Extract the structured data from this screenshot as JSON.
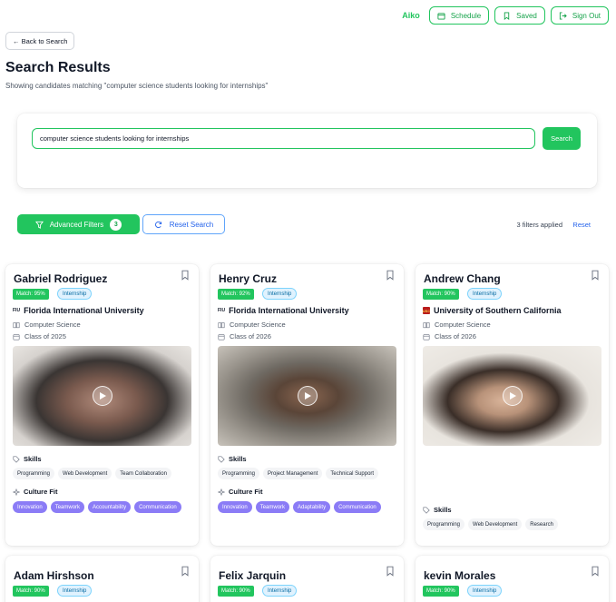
{
  "header": {
    "user_name": "Aiko",
    "schedule_label": "Schedule",
    "saved_label": "Saved",
    "signout_label": "Sign Out"
  },
  "nav": {
    "back_label": "← Back to Search"
  },
  "page": {
    "title": "Search Results",
    "subtitle": "Showing candidates matching \"computer science students looking for internships\""
  },
  "search": {
    "query": "computer science students looking for internships",
    "button_label": "Search"
  },
  "filters": {
    "advanced_label": "Advanced Filters",
    "count": "3",
    "reset_search_label": "Reset Search",
    "applied_text": "3 filters applied",
    "reset_label": "Reset"
  },
  "labels": {
    "skills": "Skills",
    "culture_fit": "Culture Fit"
  },
  "candidates": [
    {
      "name": "Gabriel Rodriguez",
      "match": "Match: 95%",
      "type": "Internship",
      "university": "Florida International University",
      "uni_logo": "FIU",
      "major": "Computer Science",
      "class_of": "Class of 2025",
      "skills": [
        "Programming",
        "Web Development",
        "Team Collaboration"
      ],
      "culture": [
        "Innovation",
        "Teamwork",
        "Accountability",
        "Communication"
      ]
    },
    {
      "name": "Henry Cruz",
      "match": "Match: 92%",
      "type": "Internship",
      "university": "Florida International University",
      "uni_logo": "FIU",
      "major": "Computer Science",
      "class_of": "Class of 2026",
      "skills": [
        "Programming",
        "Project Management",
        "Technical Support"
      ],
      "culture": [
        "Innovation",
        "Teamwork",
        "Adaptability",
        "Communication"
      ]
    },
    {
      "name": "Andrew Chang",
      "match": "Match: 90%",
      "type": "Internship",
      "university": "University of Southern California",
      "uni_logo": "USC",
      "major": "Computer Science",
      "class_of": "Class of 2026",
      "skills": [
        "Programming",
        "Web Development",
        "Research"
      ],
      "culture": []
    }
  ],
  "more_candidates": [
    {
      "name": "Adam Hirshson",
      "match": "Match: 90%",
      "type": "Internship"
    },
    {
      "name": "Felix Jarquin",
      "match": "Match: 90%",
      "type": "Internship"
    },
    {
      "name": "kevin Morales",
      "match": "Match: 90%",
      "type": "Internship"
    }
  ],
  "colors": {
    "accent": "#22c55e",
    "link": "#2563eb",
    "culture_chip": "#8b7cf6"
  }
}
